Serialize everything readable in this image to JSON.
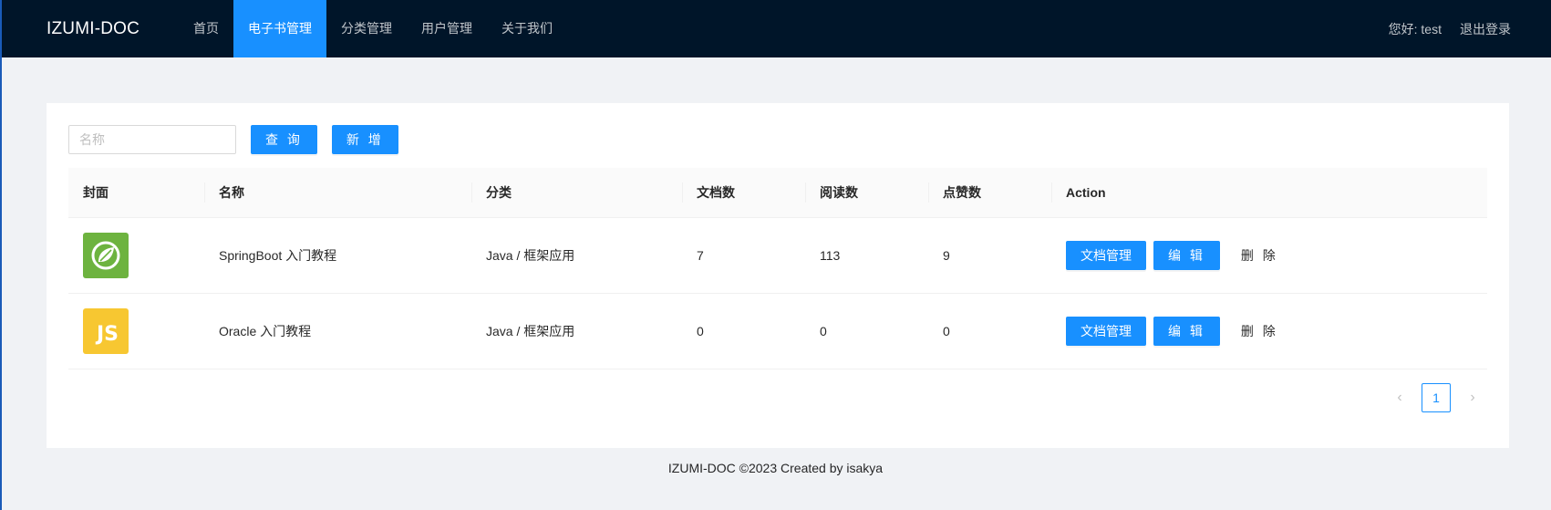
{
  "header": {
    "logo": "IZUMI-DOC",
    "nav": [
      {
        "label": "首页"
      },
      {
        "label": "电子书管理"
      },
      {
        "label": "分类管理"
      },
      {
        "label": "用户管理"
      },
      {
        "label": "关于我们"
      }
    ],
    "active_index": 1,
    "greeting": "您好: test",
    "logout": "退出登录"
  },
  "toolbar": {
    "search_placeholder": "名称",
    "search_value": "",
    "query_label": "查 询",
    "add_label": "新 增"
  },
  "table": {
    "columns": [
      "封面",
      "名称",
      "分类",
      "文档数",
      "阅读数",
      "点赞数",
      "Action"
    ],
    "rows": [
      {
        "cover_icon": "spring-leaf-icon",
        "name": "SpringBoot 入门教程",
        "category": "Java / 框架应用",
        "docs": "7",
        "views": "113",
        "likes": "9"
      },
      {
        "cover_icon": "js-logo-icon",
        "cover_text": "JS",
        "name": "Oracle 入门教程",
        "category": "Java / 框架应用",
        "docs": "0",
        "views": "0",
        "likes": "0"
      }
    ],
    "actions": {
      "docs": "文档管理",
      "edit": "编 辑",
      "delete": "删 除"
    }
  },
  "pagination": {
    "current": "1",
    "prev_icon": "chevron-left-icon",
    "next_icon": "chevron-right-icon"
  },
  "footer": {
    "text": "IZUMI-DOC ©2023 Created by isakya"
  },
  "colors": {
    "header_bg": "#001529",
    "primary": "#1890ff",
    "spring": "#6db33f",
    "js": "#f7c731"
  }
}
